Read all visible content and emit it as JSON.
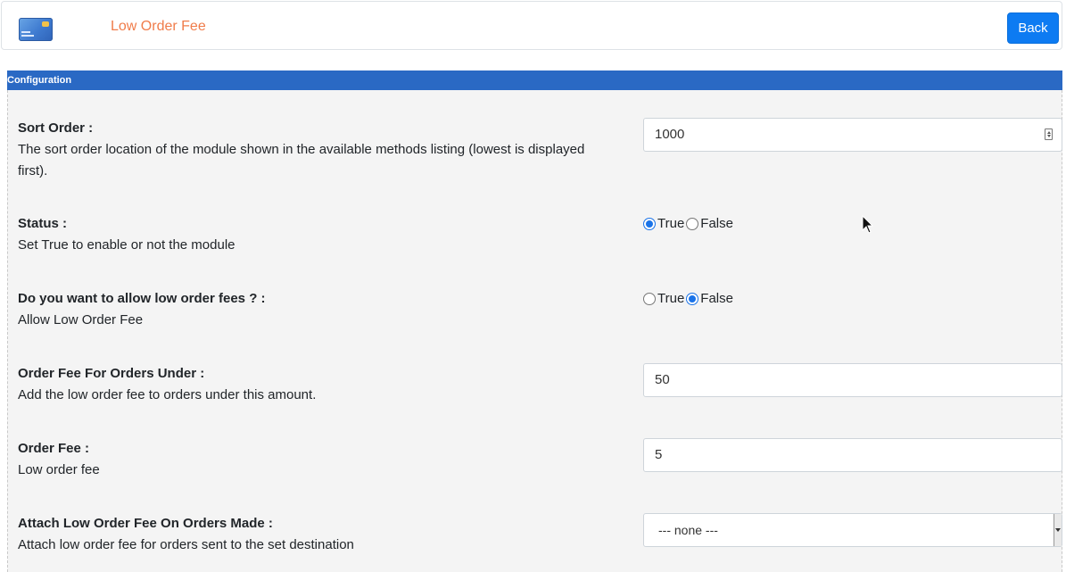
{
  "header": {
    "logo_icon": "credit-card-icon",
    "title": "Low Order Fee",
    "back_label": "Back"
  },
  "section": {
    "title": "Configuration"
  },
  "settings": [
    {
      "label": "Sort Order :",
      "description": "The sort order location of the module shown in the available methods listing (lowest is displayed first).",
      "type": "number",
      "value": "1000"
    },
    {
      "label": "Status :",
      "description": "Set True to enable or not the module",
      "type": "radio",
      "options": [
        "True",
        "False"
      ],
      "selected": "True"
    },
    {
      "label": "Do you want to allow low order fees ? :",
      "description": "Allow Low Order Fee",
      "type": "radio",
      "options": [
        "True",
        "False"
      ],
      "selected": "False"
    },
    {
      "label": "Order Fee For Orders Under :",
      "description": "Add the low order fee to orders under this amount.",
      "type": "text",
      "value": "50"
    },
    {
      "label": "Order Fee :",
      "description": "Low order fee",
      "type": "text",
      "value": "5"
    },
    {
      "label": "Attach Low Order Fee On Orders Made :",
      "description": "Attach low order fee for orders sent to the set destination",
      "type": "select",
      "value": "--- none ---"
    }
  ],
  "colors": {
    "accent": "#0d7bf2",
    "title": "#f07c4a",
    "section_bar": "#2a69c4"
  }
}
